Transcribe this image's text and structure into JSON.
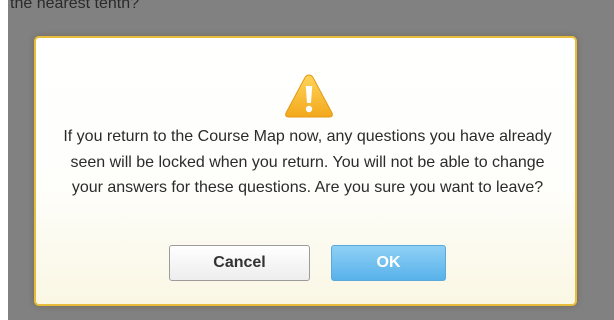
{
  "background": {
    "question_fragment": "the nearest tenth?"
  },
  "dialog": {
    "icon": "warning-icon",
    "message": "If you return to the Course Map now, any questions you have already seen will be locked when you return. You will not be able to change your answers for these questions. Are you sure you want to leave?",
    "buttons": {
      "cancel_label": "Cancel",
      "ok_label": "OK"
    }
  },
  "colors": {
    "overlay": "#818181",
    "dialog_border": "#e9bd3c",
    "warning_icon": "#f6b92a",
    "ok_button": "#58b2ea"
  }
}
